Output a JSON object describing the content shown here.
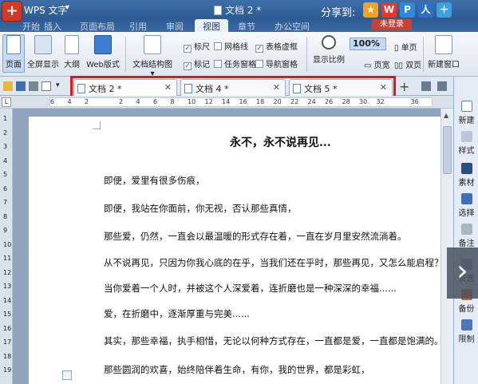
{
  "titlebar": {
    "app_name": "WPS 文字",
    "window_title": "文档 2 *",
    "share_label": "分享到:"
  },
  "menu": {
    "tabs": [
      "开始",
      "插入",
      "页面布局",
      "引用",
      "审阅",
      "视图",
      "章节",
      "办公空间"
    ],
    "active_index": 5,
    "login": "未登录"
  },
  "ribbon": {
    "page_view": "页面",
    "fullscreen": "全屏显示",
    "outline": "大纲",
    "web_layout": "Web版式",
    "doc_map": "文档结构图",
    "checkboxes": {
      "ruler": "标尺",
      "gridlines": "网格线",
      "table_borders": "表格虚框",
      "marks": "标记",
      "task_pane": "任务窗格",
      "nav_pane": "导航窗格"
    },
    "zoom_label": "显示比例",
    "zoom_value": "100%",
    "page_width": "页宽",
    "single_page": "单页",
    "two_pages": "双页",
    "new_window": "新建窗口"
  },
  "tabs": [
    {
      "label": "文档 2 *",
      "active": true
    },
    {
      "label": "文档 4 *",
      "active": false
    },
    {
      "label": "文档 5 *",
      "active": false
    }
  ],
  "ruler": {
    "ticks": [
      "6",
      "4",
      "2",
      "",
      "2",
      "4",
      "6",
      "8",
      "10",
      "12",
      "14",
      "16",
      "18",
      "20",
      "22",
      "24",
      "26",
      "28",
      "30",
      "32",
      "",
      "36"
    ],
    "vticks": [
      "1",
      "2",
      "3",
      "4",
      "5",
      "6",
      "7",
      "8",
      "9",
      "10",
      "11",
      "12",
      "13",
      "14",
      "15",
      "16",
      "17",
      "18",
      "19"
    ]
  },
  "document": {
    "title": "永不，永不说再见...",
    "paragraphs": [
      "即便，爱里有很多伤痕，",
      "即便，我站在你面前，你无视，否认那些真情，",
      "那些爱，仍然，一直会以最温暖的形式存在着，一直在岁月里安然流淌着。",
      "从不说再见，只因为你我心底的在乎，当我们还在乎时，那些再见，又怎么能启程？",
      "当你爱着一个人时，并被这个人深爱着，连折磨也是一种深深的幸福......",
      "爱，在折磨中，逐渐厚重与完美......",
      "其实，那些幸福，执手相惜，无论以何种方式存在，一直都是爱，一直都是饱满的。",
      "那些圆润的欢喜，始终陪伴着生命，有你，我的世界，都是彩虹，"
    ]
  },
  "taskpane": {
    "items": [
      "新建",
      "样式",
      "素材",
      "选择",
      "备注",
      "发送",
      "备份",
      "限制"
    ]
  }
}
